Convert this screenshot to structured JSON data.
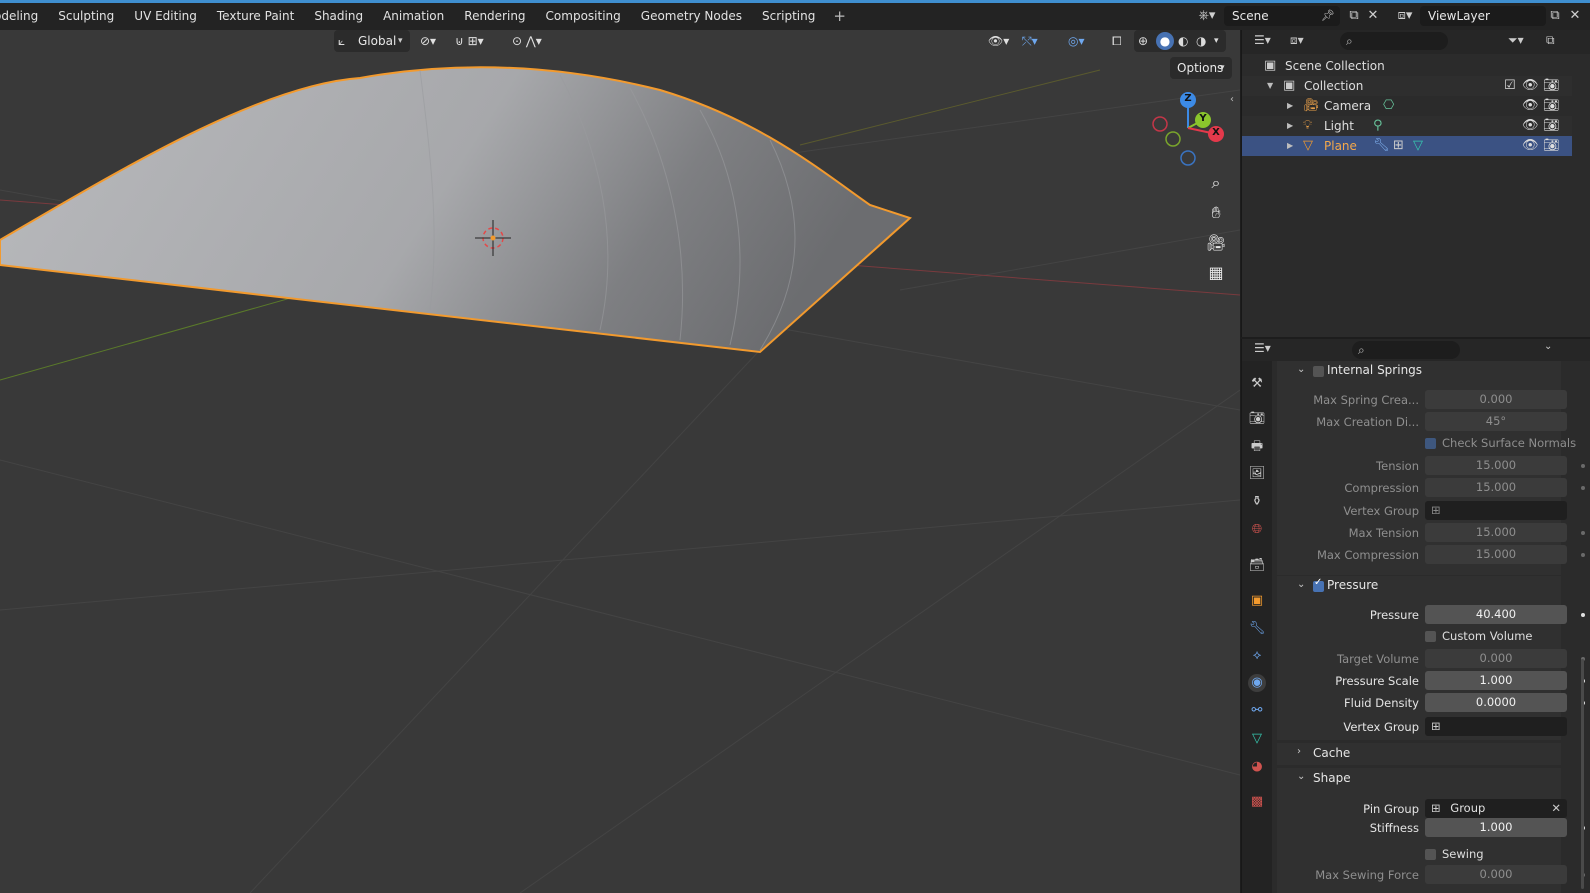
{
  "workspace_tabs": [
    "odeling",
    "Sculpting",
    "UV Editing",
    "Texture Paint",
    "Shading",
    "Animation",
    "Rendering",
    "Compositing",
    "Geometry Nodes",
    "Scripting"
  ],
  "scene_name": "Scene",
  "view_layer": "ViewLayer",
  "viewport": {
    "transform_orientation": "Global",
    "options_label": "Options",
    "gizmo_axes": [
      "Z",
      "Y",
      "X"
    ]
  },
  "outliner": {
    "rows": [
      {
        "label": "Scene Collection"
      },
      {
        "label": "Collection"
      },
      {
        "label": "Camera"
      },
      {
        "label": "Light"
      },
      {
        "label": "Plane"
      }
    ]
  },
  "properties": {
    "internal_springs": {
      "title": "Internal Springs",
      "enabled": false,
      "max_spring_creation_length_label": "Max Spring Crea...",
      "max_spring_creation_length": "0.000",
      "max_creation_diversion_label": "Max Creation Di...",
      "max_creation_diversion": "45°",
      "check_surface_normals_label": "Check Surface Normals",
      "check_surface_normals": true,
      "tension_label": "Tension",
      "tension": "15.000",
      "compression_label": "Compression",
      "compression": "15.000",
      "vertex_group_label": "Vertex Group",
      "max_tension_label": "Max Tension",
      "max_tension": "15.000",
      "max_compression_label": "Max Compression",
      "max_compression": "15.000"
    },
    "pressure": {
      "title": "Pressure",
      "enabled": true,
      "pressure_label": "Pressure",
      "pressure": "40.400",
      "custom_volume_label": "Custom Volume",
      "custom_volume": false,
      "target_volume_label": "Target Volume",
      "target_volume": "0.000",
      "pressure_scale_label": "Pressure Scale",
      "pressure_scale": "1.000",
      "fluid_density_label": "Fluid Density",
      "fluid_density": "0.0000",
      "vertex_group_label": "Vertex Group"
    },
    "cache": {
      "title": "Cache"
    },
    "shape": {
      "title": "Shape",
      "pin_group_label": "Pin Group",
      "pin_group": "Group",
      "stiffness_label": "Stiffness",
      "stiffness": "1.000",
      "sewing_label": "Sewing",
      "sewing": false,
      "max_sewing_force_label": "Max Sewing Force",
      "max_sewing_force": "0.000"
    }
  },
  "colors": {
    "selection_outline": "#f29a2e",
    "active_row": "#3b5283",
    "checkbox_on": "#4772b3",
    "axis_x": "#e4394b",
    "axis_y": "#8ac52c",
    "axis_z": "#3c8ae5"
  }
}
